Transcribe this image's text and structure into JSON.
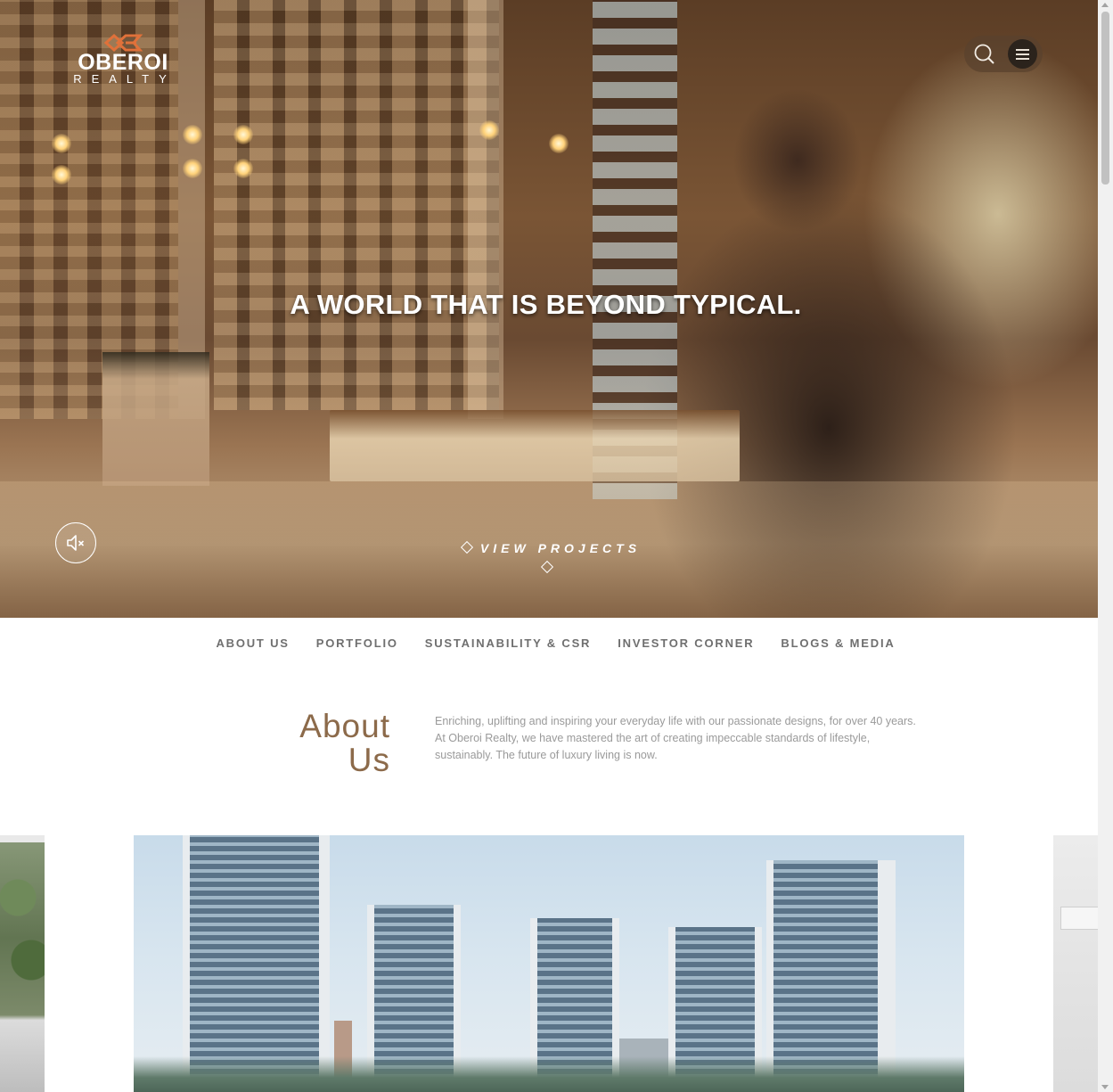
{
  "brand": {
    "name": "OBEROI",
    "sub": "REALTY",
    "logo_color": "#e0713a"
  },
  "hero": {
    "headline": "A WORLD THAT IS BEYOND TYPICAL.",
    "cta": "VIEW PROJECTS"
  },
  "header_tools": {
    "search_icon": "search-icon",
    "menu_icon": "hamburger-menu-icon"
  },
  "mute": {
    "icon": "speaker-muted-icon"
  },
  "nav": {
    "items": [
      {
        "label": "ABOUT US"
      },
      {
        "label": "PORTFOLIO"
      },
      {
        "label": "SUSTAINABILITY & CSR"
      },
      {
        "label": "INVESTOR CORNER"
      },
      {
        "label": "BLOGS & MEDIA"
      }
    ]
  },
  "about": {
    "title_line1": "About",
    "title_line2": "Us",
    "text": "Enriching, uplifting and inspiring your everyday life with our passionate designs, for over 40 years. At Oberoi Realty, we have mastered the art of creating impeccable standards of lifestyle, sustainably. The future of luxury living is now."
  },
  "colors": {
    "accent": "#8c6a4a",
    "nav_text": "#6f6f6f",
    "body_text": "#9a9a9a"
  }
}
